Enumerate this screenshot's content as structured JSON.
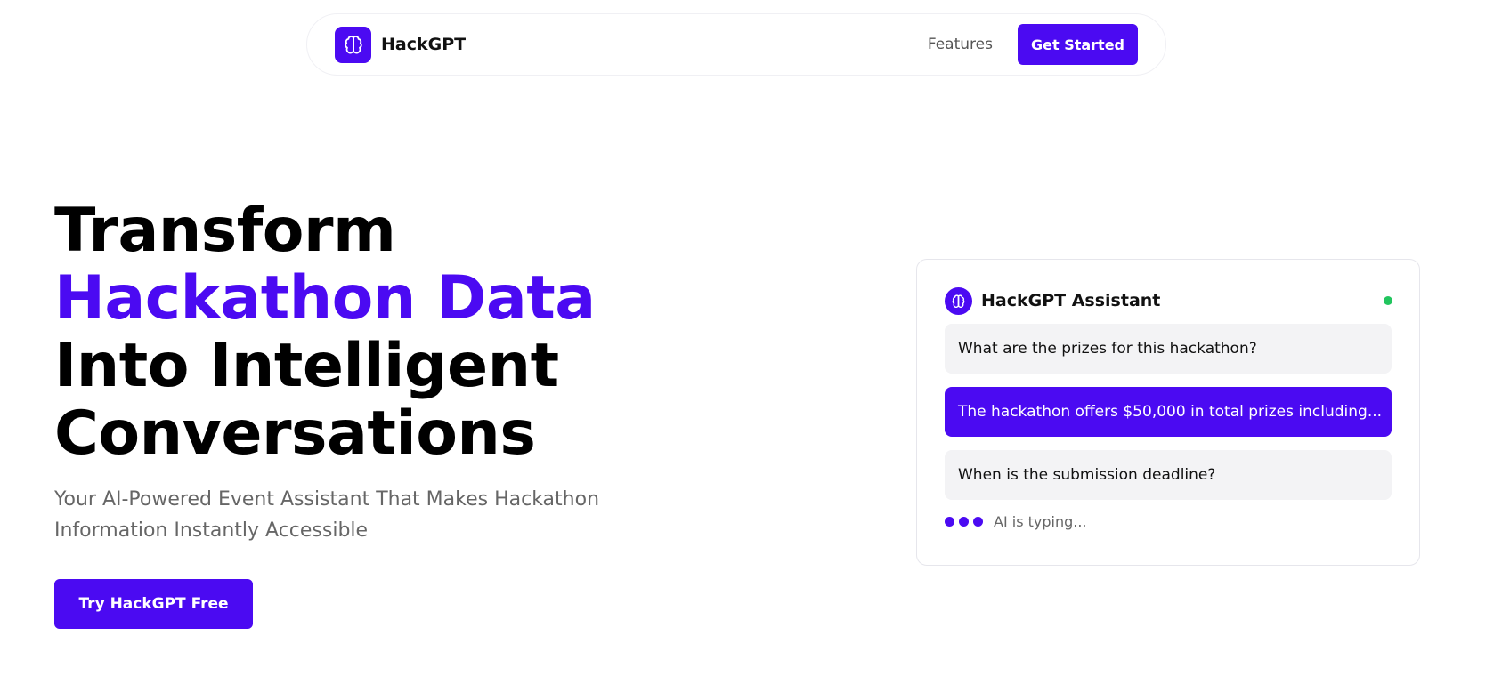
{
  "nav": {
    "brand": "HackGPT",
    "links": [
      "Features"
    ],
    "cta_label": "Get Started"
  },
  "hero": {
    "title_line1": "Transform",
    "title_line2": "Hackathon Data",
    "title_line3": "Into Intelligent",
    "title_line4": "Conversations",
    "subtitle": "Your AI-Powered Event Assistant That Makes Hackathon Information Instantly Accessible",
    "cta_label": "Try HackGPT Free"
  },
  "chat": {
    "title": "HackGPT Assistant",
    "status": "online",
    "messages": [
      {
        "role": "user",
        "text": "What are the prizes for this hackathon?"
      },
      {
        "role": "ai",
        "text": "The hackathon offers $50,000 in total prizes including..."
      },
      {
        "role": "user",
        "text": "When is the submission deadline?"
      }
    ],
    "typing_label": "AI is typing..."
  },
  "colors": {
    "accent": "#4b0af2",
    "status_online": "#22c55e",
    "muted_text": "#666666",
    "bubble_bg": "#f3f3f5"
  },
  "icons": {
    "brand": "brain-icon",
    "chat": "brain-icon"
  }
}
